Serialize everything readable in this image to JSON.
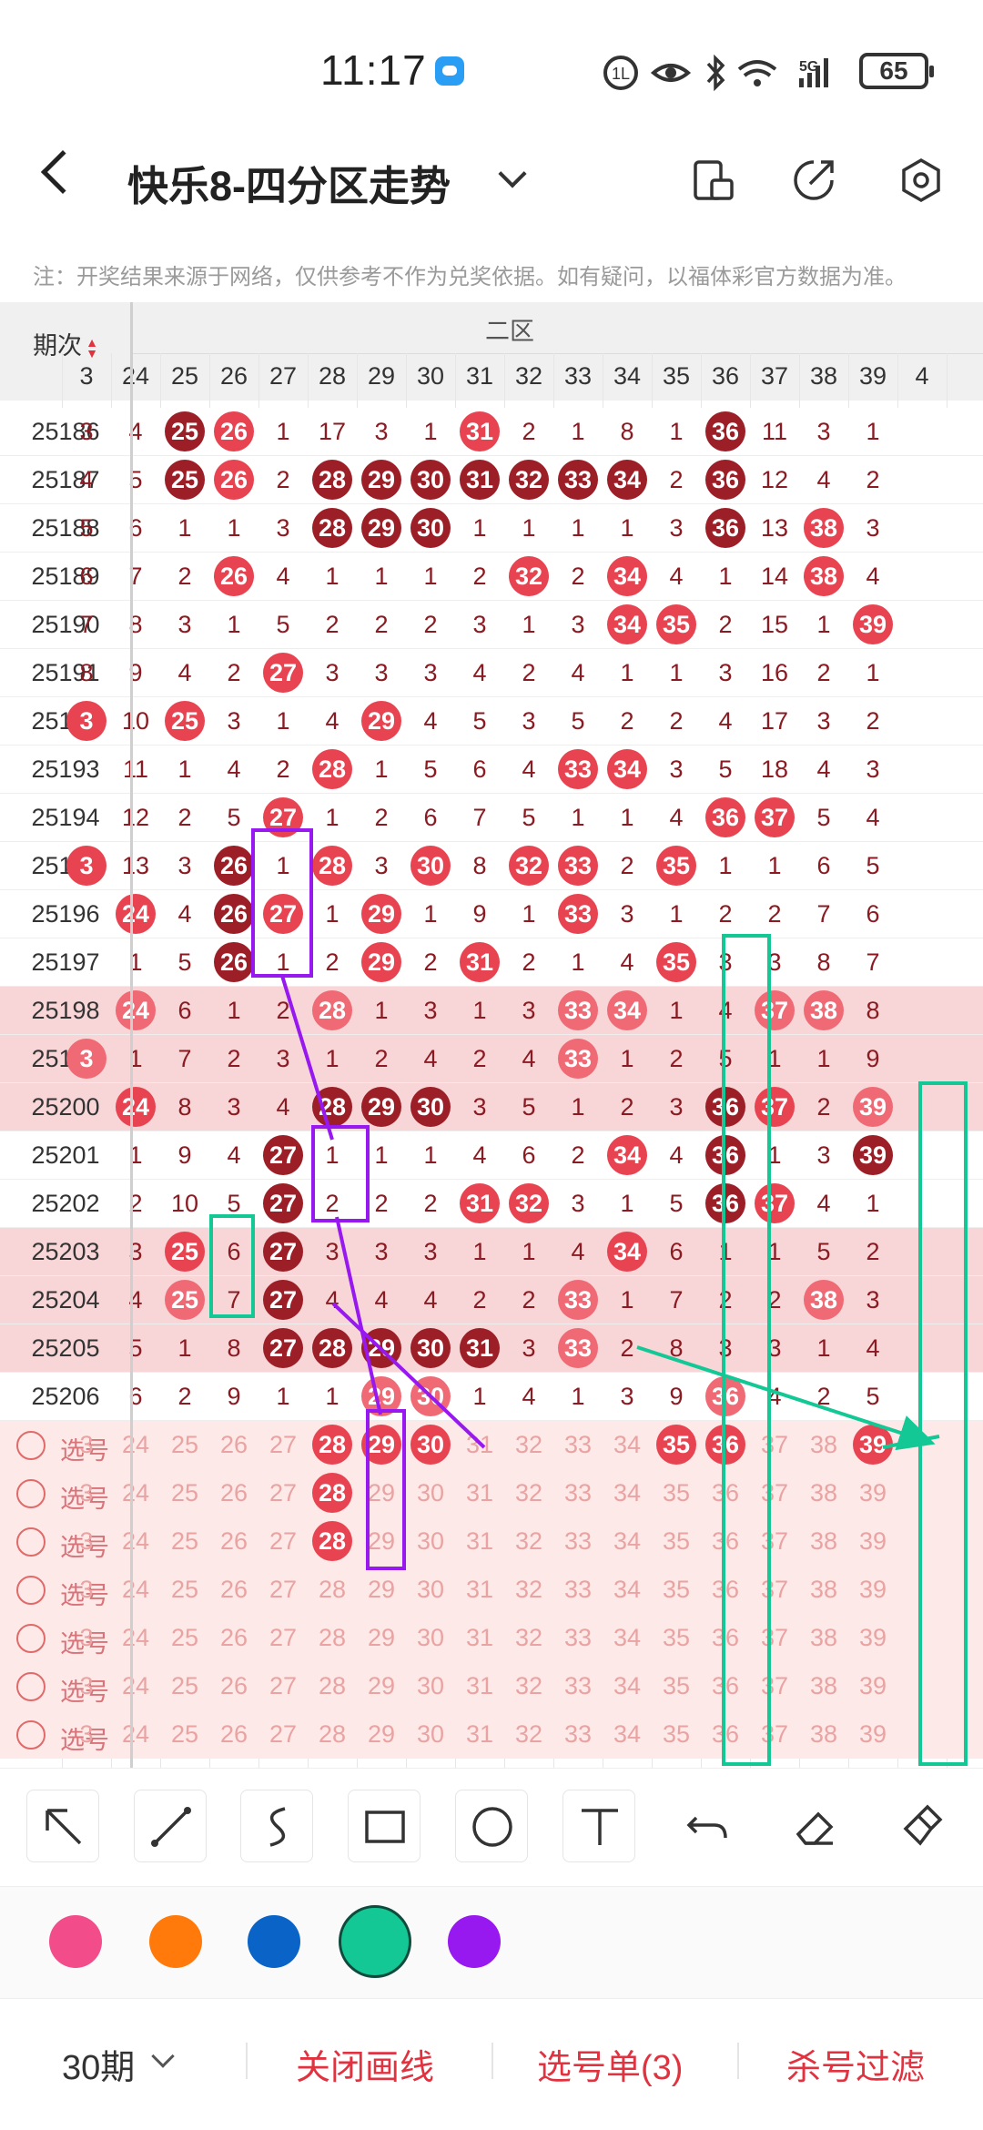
{
  "status": {
    "time": "11:17",
    "battery": "65",
    "network": "5G"
  },
  "nav": {
    "title": "快乐8-四分区走势"
  },
  "notice": "注：开奖结果来源于网络，仅供参考不作为兑奖依据。如有疑问，以福体彩官方数据为准。",
  "table": {
    "period_header": "期次",
    "zone_label": "二区",
    "columns": [
      "3",
      "24",
      "25",
      "26",
      "27",
      "28",
      "29",
      "30",
      "31",
      "32",
      "33",
      "34",
      "35",
      "36",
      "37",
      "38",
      "39",
      "4"
    ],
    "rows": [
      {
        "period": "25186",
        "cells": [
          "3",
          "4",
          "25",
          "26",
          "1",
          "17",
          "3",
          "1",
          "31",
          "2",
          "1",
          "8",
          "1",
          "36",
          "11",
          "3",
          "1",
          ""
        ],
        "balls": {
          "2": "d",
          "3": "r",
          "8": "r",
          "13": "d"
        }
      },
      {
        "period": "25187",
        "cells": [
          "4",
          "5",
          "25",
          "26",
          "2",
          "28",
          "29",
          "30",
          "31",
          "32",
          "33",
          "34",
          "2",
          "36",
          "12",
          "4",
          "2",
          ""
        ],
        "balls": {
          "2": "d",
          "3": "r",
          "5": "d",
          "6": "d",
          "7": "d",
          "8": "d",
          "9": "d",
          "10": "d",
          "11": "d",
          "13": "d"
        }
      },
      {
        "period": "25188",
        "cells": [
          "5",
          "6",
          "1",
          "1",
          "3",
          "28",
          "29",
          "30",
          "1",
          "1",
          "1",
          "1",
          "3",
          "36",
          "13",
          "38",
          "3",
          ""
        ],
        "balls": {
          "5": "d",
          "6": "d",
          "7": "d",
          "13": "d",
          "15": "r",
          "17": "r"
        }
      },
      {
        "period": "25189",
        "cells": [
          "6",
          "7",
          "2",
          "26",
          "4",
          "1",
          "1",
          "1",
          "2",
          "32",
          "2",
          "34",
          "4",
          "1",
          "14",
          "38",
          "4",
          ""
        ],
        "balls": {
          "3": "r",
          "9": "r",
          "11": "r",
          "15": "r"
        }
      },
      {
        "period": "25190",
        "cells": [
          "7",
          "8",
          "3",
          "1",
          "5",
          "2",
          "2",
          "2",
          "3",
          "1",
          "3",
          "34",
          "35",
          "2",
          "15",
          "1",
          "39",
          ""
        ],
        "balls": {
          "11": "r",
          "12": "r",
          "16": "r"
        }
      },
      {
        "period": "25191",
        "cells": [
          "8",
          "9",
          "4",
          "2",
          "27",
          "3",
          "3",
          "3",
          "4",
          "2",
          "4",
          "1",
          "1",
          "3",
          "16",
          "2",
          "1",
          ""
        ],
        "balls": {
          "4": "r"
        }
      },
      {
        "period": "25192",
        "cells": [
          "3",
          "10",
          "25",
          "3",
          "1",
          "4",
          "29",
          "4",
          "5",
          "3",
          "5",
          "2",
          "2",
          "4",
          "17",
          "3",
          "2",
          ""
        ],
        "balls": {
          "0": "r",
          "2": "r",
          "6": "r",
          "17": "r"
        }
      },
      {
        "period": "25193",
        "cells": [
          "",
          "11",
          "1",
          "4",
          "2",
          "28",
          "1",
          "5",
          "6",
          "4",
          "33",
          "34",
          "3",
          "5",
          "18",
          "4",
          "3",
          ""
        ],
        "balls": {
          "5": "r",
          "10": "r",
          "11": "r"
        }
      },
      {
        "period": "25194",
        "cells": [
          "",
          "12",
          "2",
          "5",
          "27",
          "1",
          "2",
          "6",
          "7",
          "5",
          "1",
          "1",
          "4",
          "36",
          "37",
          "5",
          "4",
          ""
        ],
        "balls": {
          "4": "r",
          "13": "r",
          "14": "r",
          "17": "d"
        }
      },
      {
        "period": "25195",
        "cells": [
          "3",
          "13",
          "3",
          "26",
          "1",
          "28",
          "3",
          "30",
          "8",
          "32",
          "33",
          "2",
          "35",
          "1",
          "1",
          "6",
          "5",
          ""
        ],
        "balls": {
          "0": "r",
          "3": "d",
          "5": "r",
          "7": "r",
          "9": "r",
          "10": "r",
          "12": "r"
        }
      },
      {
        "period": "25196",
        "cells": [
          "",
          "24",
          "4",
          "26",
          "27",
          "1",
          "29",
          "1",
          "9",
          "1",
          "33",
          "3",
          "1",
          "2",
          "2",
          "7",
          "6",
          ""
        ],
        "balls": {
          "1": "r",
          "3": "d",
          "4": "r",
          "6": "r",
          "10": "r"
        }
      },
      {
        "period": "25197",
        "cells": [
          "",
          "1",
          "5",
          "26",
          "1",
          "2",
          "29",
          "2",
          "31",
          "2",
          "1",
          "4",
          "35",
          "3",
          "3",
          "8",
          "7",
          ""
        ],
        "balls": {
          "3": "d",
          "6": "r",
          "8": "r",
          "12": "r"
        }
      },
      {
        "period": "25198",
        "cells": [
          "",
          "24",
          "6",
          "1",
          "2",
          "28",
          "1",
          "3",
          "1",
          "3",
          "33",
          "34",
          "1",
          "4",
          "37",
          "38",
          "8",
          ""
        ],
        "balls": {
          "1": "l",
          "5": "l",
          "10": "l",
          "11": "l",
          "14": "l",
          "15": "l"
        }
      },
      {
        "period": "25199",
        "cells": [
          "3",
          "1",
          "7",
          "2",
          "3",
          "1",
          "2",
          "4",
          "2",
          "4",
          "33",
          "1",
          "2",
          "5",
          "1",
          "1",
          "9",
          ""
        ],
        "balls": {
          "0": "l",
          "10": "l"
        }
      },
      {
        "period": "25200",
        "cells": [
          "",
          "24",
          "8",
          "3",
          "4",
          "28",
          "29",
          "30",
          "3",
          "5",
          "1",
          "2",
          "3",
          "36",
          "37",
          "2",
          "39",
          ""
        ],
        "balls": {
          "1": "r",
          "5": "d",
          "6": "d",
          "7": "d",
          "13": "d",
          "14": "r",
          "16": "l"
        }
      },
      {
        "period": "25201",
        "cells": [
          "",
          "1",
          "9",
          "4",
          "27",
          "1",
          "1",
          "1",
          "4",
          "6",
          "2",
          "34",
          "4",
          "36",
          "1",
          "3",
          "39",
          ""
        ],
        "balls": {
          "4": "d",
          "11": "r",
          "13": "d",
          "16": "d",
          "17": "d"
        }
      },
      {
        "period": "25202",
        "cells": [
          "",
          "2",
          "10",
          "5",
          "27",
          "2",
          "2",
          "2",
          "31",
          "32",
          "3",
          "1",
          "5",
          "36",
          "37",
          "4",
          "1",
          ""
        ],
        "balls": {
          "4": "d",
          "8": "r",
          "9": "r",
          "13": "d",
          "14": "r"
        }
      },
      {
        "period": "25203",
        "cells": [
          "",
          "3",
          "25",
          "6",
          "27",
          "3",
          "3",
          "3",
          "1",
          "1",
          "4",
          "34",
          "6",
          "1",
          "1",
          "5",
          "2",
          ""
        ],
        "balls": {
          "2": "r",
          "4": "d",
          "11": "r",
          "17": "r"
        }
      },
      {
        "period": "25204",
        "cells": [
          "",
          "4",
          "25",
          "7",
          "27",
          "4",
          "4",
          "4",
          "2",
          "2",
          "33",
          "1",
          "7",
          "2",
          "2",
          "38",
          "3",
          ""
        ],
        "balls": {
          "2": "l",
          "4": "d",
          "10": "l",
          "15": "l"
        }
      },
      {
        "period": "25205",
        "cells": [
          "",
          "5",
          "1",
          "8",
          "27",
          "28",
          "29",
          "30",
          "31",
          "3",
          "33",
          "2",
          "8",
          "3",
          "3",
          "1",
          "4",
          ""
        ],
        "balls": {
          "4": "d",
          "5": "d",
          "6": "d",
          "7": "d",
          "8": "d",
          "10": "l"
        }
      },
      {
        "period": "25206",
        "cells": [
          "",
          "6",
          "2",
          "9",
          "1",
          "1",
          "29",
          "30",
          "1",
          "4",
          "1",
          "3",
          "9",
          "36",
          "4",
          "2",
          "5",
          ""
        ],
        "balls": {
          "6": "l",
          "7": "l",
          "13": "l"
        }
      }
    ],
    "select_label": "选号",
    "select_rows": 7,
    "select_balls": [
      {
        "row": 0,
        "col": 5
      },
      {
        "row": 0,
        "col": 6
      },
      {
        "row": 0,
        "col": 7
      },
      {
        "row": 0,
        "col": 12
      },
      {
        "row": 0,
        "col": 13
      },
      {
        "row": 0,
        "col": 16
      },
      {
        "row": 1,
        "col": 5
      },
      {
        "row": 2,
        "col": 5
      }
    ]
  },
  "colors": {
    "red": "#e84350",
    "dark": "#9c1e26",
    "light": "#f06a75",
    "pink": "#f24d8a",
    "orange": "#ff7a0a",
    "blue": "#0a64c8",
    "green": "#14c896",
    "purple": "#9818f0"
  },
  "tools": [
    "arrow-tool",
    "line-tool",
    "curve-tool",
    "rectangle-tool",
    "circle-tool",
    "text-tool",
    "undo-tool",
    "eraser-tool",
    "clear-tool"
  ],
  "bottom": {
    "period_select": "30期",
    "close_lines": "关闭画线",
    "selection_list": "选号单(3)",
    "kill_filter": "杀号过滤"
  }
}
